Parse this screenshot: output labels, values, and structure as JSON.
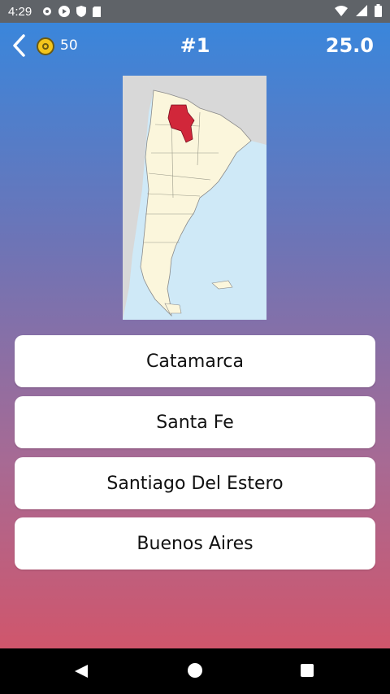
{
  "status": {
    "time": "4:29",
    "icons": [
      "gear-icon",
      "play-protect-icon",
      "shield-icon",
      "sd-card-icon"
    ],
    "right_icons": [
      "wifi-icon",
      "signal-icon",
      "battery-icon"
    ]
  },
  "header": {
    "coins": "50",
    "question_number": "#1",
    "score": "25.0"
  },
  "map": {
    "subject": "Argentina map",
    "highlight_color": "#d1273a",
    "land_color": "#fbf6dc",
    "sea_color": "#cfe9f7",
    "neighbor_color": "#d8d8d8"
  },
  "answers": [
    {
      "label": "Catamarca"
    },
    {
      "label": "Santa Fe"
    },
    {
      "label": "Santiago Del Estero"
    },
    {
      "label": "Buenos Aires"
    }
  ]
}
